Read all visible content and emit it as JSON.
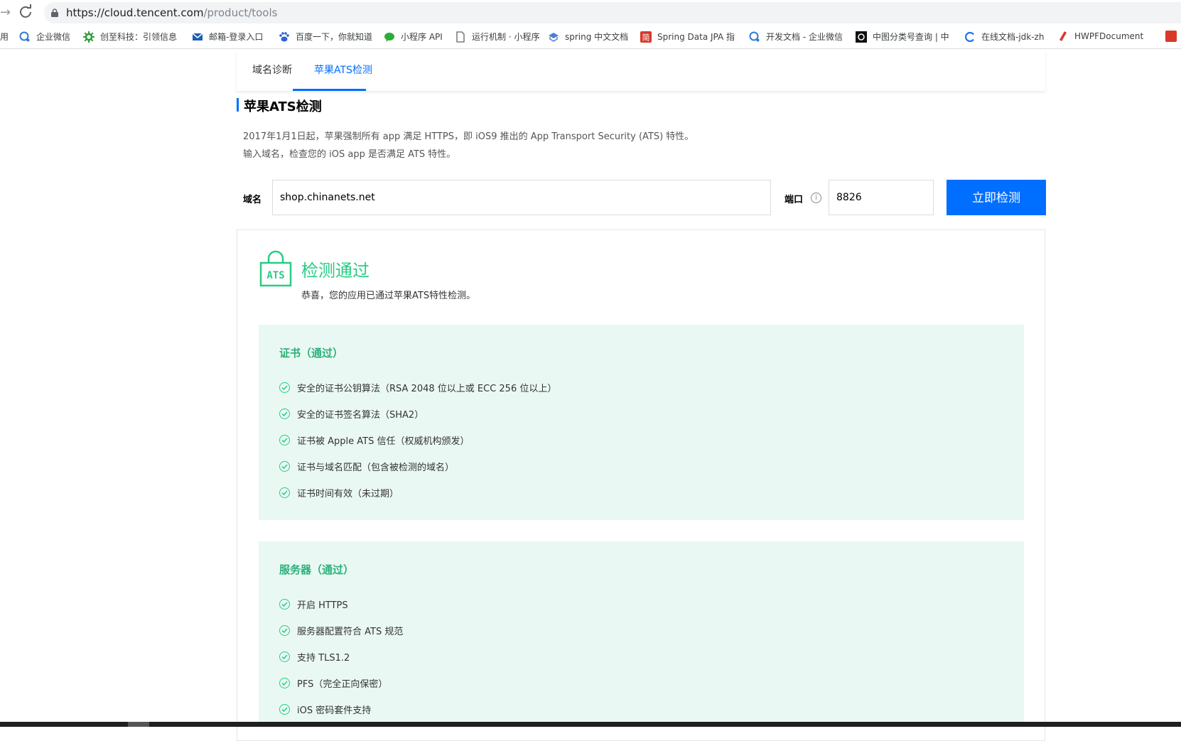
{
  "browser": {
    "url_host": "https://cloud.tencent.com",
    "url_path": "/product/tools",
    "bookmarks": [
      {
        "label": "用",
        "icon": "apps-icon"
      },
      {
        "label": "企业微信",
        "icon": "wecom-icon"
      },
      {
        "label": "创至科技：引领信息",
        "icon": "gear-green-icon"
      },
      {
        "label": "邮箱-登录入口",
        "icon": "mail-icon"
      },
      {
        "label": "百度一下，你就知道",
        "icon": "baidu-icon"
      },
      {
        "label": "小程序 API",
        "icon": "wechat-icon"
      },
      {
        "label": "运行机制 · 小程序",
        "icon": "page-icon"
      },
      {
        "label": "spring 中文文档",
        "icon": "book-icon"
      },
      {
        "label": "Spring Data JPA 指",
        "icon": "jian-icon"
      },
      {
        "label": "开发文档 - 企业微信",
        "icon": "wecom-icon"
      },
      {
        "label": "中图分类号查询 | 中",
        "icon": "black-square-icon"
      },
      {
        "label": "在线文档-jdk-zh",
        "icon": "c-icon"
      },
      {
        "label": "HWPFDocument",
        "icon": "pen-icon"
      }
    ]
  },
  "tabs": [
    {
      "label": "域名诊断"
    },
    {
      "label": "苹果ATS检测"
    }
  ],
  "section": {
    "title": "苹果ATS检测",
    "desc1": "2017年1月1日起，苹果强制所有 app 满足 HTTPS，即 iOS9 推出的 App Transport Security (ATS) 特性。",
    "desc2": "输入域名，检查您的 iOS app 是否满足 ATS 特性。"
  },
  "form": {
    "domain_label": "域名",
    "domain_value": "shop.chinanets.net",
    "port_label": "端口",
    "port_value": "8826",
    "info_icon": "i",
    "submit_label": "立即检测"
  },
  "result": {
    "icon_text": "ATS",
    "title": "检测通过",
    "subtitle": "恭喜，您的应用已通过苹果ATS特性检测。",
    "accent_color": "#29cc85",
    "certificate": {
      "title": "证书（通过）",
      "items": [
        "安全的证书公钥算法（RSA 2048 位以上或 ECC 256 位以上）",
        "安全的证书签名算法（SHA2）",
        "证书被 Apple ATS 信任（权威机构颁发）",
        "证书与域名匹配（包含被检测的域名）",
        "证书时间有效（未过期）"
      ]
    },
    "server": {
      "title": "服务器（通过）",
      "items": [
        "开启 HTTPS",
        "服务器配置符合 ATS 规范",
        "支持 TLS1.2",
        "PFS（完全正向保密）",
        "iOS 密码套件支持"
      ]
    }
  }
}
